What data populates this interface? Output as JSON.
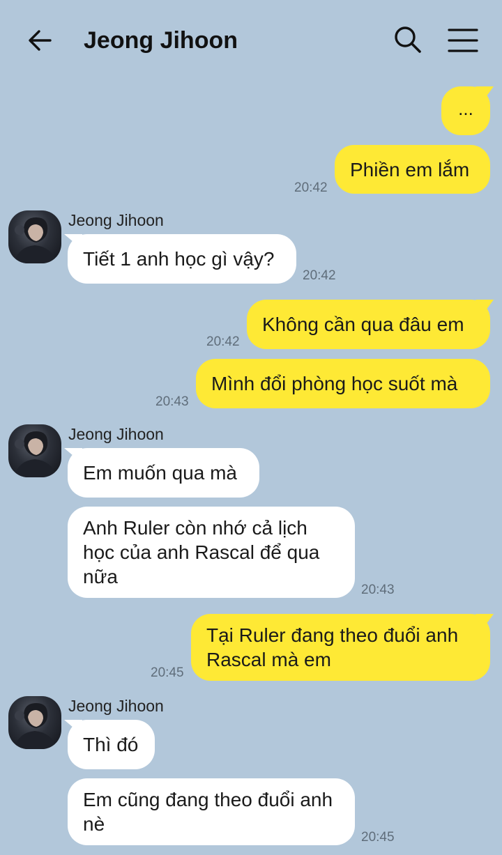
{
  "header": {
    "title": "Jeong Jihoon",
    "back_icon": "arrow-left-icon",
    "search_icon": "search-icon",
    "menu_icon": "hamburger-menu-icon"
  },
  "colors": {
    "background": "#b2c7da",
    "outgoing_bubble": "#fee935",
    "incoming_bubble": "#ffffff"
  },
  "messages": [
    {
      "dir": "out",
      "text": "...",
      "time": ""
    },
    {
      "dir": "out",
      "text": "Phiền em lắm",
      "time": "20:42"
    },
    {
      "dir": "in",
      "sender": "Jeong Jihoon",
      "text": "Tiết 1 anh học gì vậy?",
      "time": "20:42"
    },
    {
      "dir": "out",
      "text": "Không cần qua đâu em",
      "time": "20:42"
    },
    {
      "dir": "out",
      "text": "Mình đổi phòng học suốt mà",
      "time": "20:43"
    },
    {
      "dir": "in",
      "sender": "Jeong Jihoon",
      "text": "Em muốn qua mà",
      "time": ""
    },
    {
      "dir": "in",
      "text": "Anh Ruler còn nhớ cả lịch học của anh Rascal để qua nữa",
      "time": "20:43"
    },
    {
      "dir": "out",
      "text": "Tại Ruler đang theo đuổi anh Rascal mà em",
      "time": "20:45"
    },
    {
      "dir": "in",
      "sender": "Jeong Jihoon",
      "text": "Thì đó",
      "time": ""
    },
    {
      "dir": "in",
      "text": "Em cũng đang theo đuổi anh nè",
      "time": "20:45"
    }
  ]
}
